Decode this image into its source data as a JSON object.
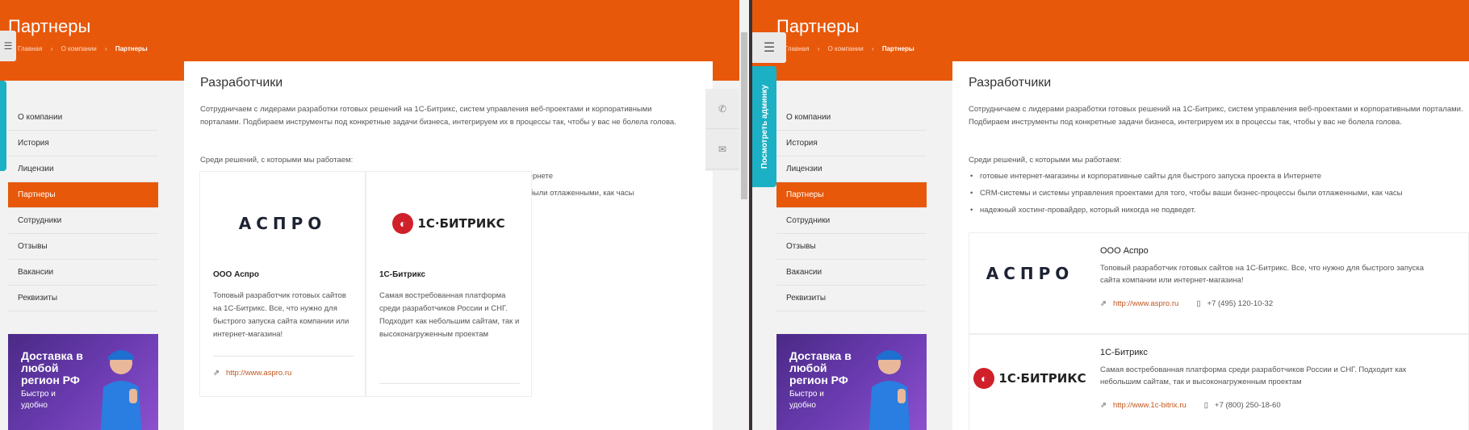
{
  "page": {
    "title": "Партнеры",
    "breadcrumb": [
      "Главная",
      "О компании",
      "Партнеры"
    ]
  },
  "admin": {
    "label": "Посмотреть админку"
  },
  "sidebar": {
    "items": [
      {
        "label": "О компании",
        "active": false
      },
      {
        "label": "История",
        "active": false
      },
      {
        "label": "Лицензии",
        "active": false
      },
      {
        "label": "Партнеры",
        "active": true
      },
      {
        "label": "Сотрудники",
        "active": false
      },
      {
        "label": "Отзывы",
        "active": false
      },
      {
        "label": "Вакансии",
        "active": false
      },
      {
        "label": "Реквизиты",
        "active": false
      }
    ]
  },
  "banner": {
    "title": "Доставка в любой регион РФ",
    "subtitle": "Быстро и удобно"
  },
  "section": {
    "title": "Разработчики",
    "intro": "Сотрудничаем с лидерами разработки готовых решений на 1С-Битрикс, систем управления веб-проектами и корпоративными порталами. Подбираем инструменты под конкретные задачи бизнеса, интегрируем их в процессы так, чтобы у вас не болела голова.",
    "solutions_label": "Среди решений, с которыми мы работаем:",
    "bullets": [
      "готовые интернет-магазины и корпоративные сайты для быстрого запуска проекта в Интернете",
      "CRM-системы и системы управления проектами для того, чтобы ваши бизнес-процессы были отлаженными, как часы",
      "надежный хостинг-провайдер, который никогда не подведет."
    ]
  },
  "partners": [
    {
      "logo_text": "АСПРО",
      "name": "ООО Аспро",
      "desc": "Топовый разработчик готовых сайтов на 1С-Битрикс. Все, что нужно для быстрого запуска сайта компании или интернет-магазина!",
      "url": "http://www.aspro.ru",
      "phone": "+7 (495) 120-10-32"
    },
    {
      "logo_text": "1С·БИТРИКС",
      "name": "1С-Битрикс",
      "desc": "Самая востребованная платформа среди разработчиков России и СНГ. Подходит как небольшим сайтам, так и высоконагруженным проектам",
      "url": "http://www.1c-bitrix.ru",
      "phone": "+7 (800) 250-18-60"
    }
  ],
  "icons": {
    "settings": "sliders-icon",
    "phone": "phone-icon",
    "mail": "mail-icon",
    "link": "external-link-icon",
    "mobile": "mobile-phone-icon"
  },
  "colors": {
    "accent": "#e8580a",
    "admin": "#1cb0c4",
    "link": "#c0561e"
  }
}
